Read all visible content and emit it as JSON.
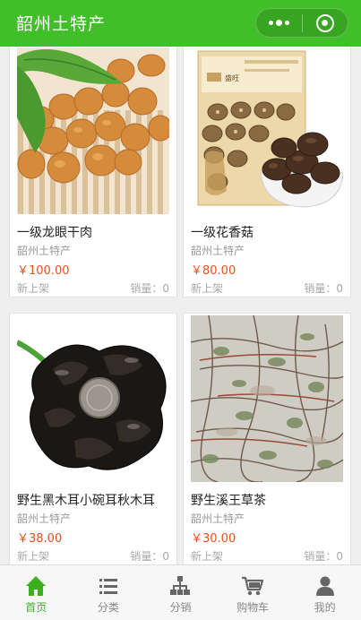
{
  "header": {
    "title": "韶州土特产"
  },
  "products": [
    {
      "name": "一级龙眼干肉",
      "shop": "韶州土特产",
      "price": "￥100.00",
      "tag": "新上架",
      "sales": "销量：0"
    },
    {
      "name": "一级花香菇",
      "shop": "韶州土特产",
      "price": "￥80.00",
      "tag": "新上架",
      "sales": "销量：0",
      "package_brand": "盛旺"
    },
    {
      "name": "野生黑木耳小碗耳秋木耳",
      "shop": "韶州土特产",
      "price": "￥38.00",
      "tag": "新上架",
      "sales": "销量：0"
    },
    {
      "name": "野生溪王草茶",
      "shop": "韶州土特产",
      "price": "￥30.00",
      "tag": "新上架",
      "sales": "销量：0"
    }
  ],
  "tabbar": {
    "items": [
      {
        "label": "首页",
        "icon": "home-icon",
        "active": true
      },
      {
        "label": "分类",
        "icon": "list-icon",
        "active": false
      },
      {
        "label": "分销",
        "icon": "org-chart-icon",
        "active": false
      },
      {
        "label": "购物车",
        "icon": "cart-icon",
        "active": false
      },
      {
        "label": "我的",
        "icon": "user-icon",
        "active": false
      }
    ]
  },
  "colors": {
    "brand": "#40bf28",
    "price": "#e8501f",
    "active_tab": "#3cb021"
  }
}
